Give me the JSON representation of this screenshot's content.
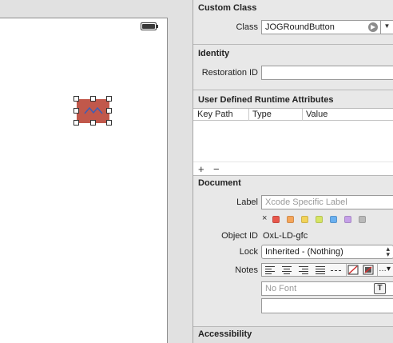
{
  "canvas": {
    "selected_element_color": "#c1584b"
  },
  "custom_class": {
    "title": "Custom Class",
    "class_label": "Class",
    "class_value": "JOGRoundButton"
  },
  "identity": {
    "title": "Identity",
    "restoration_id_label": "Restoration ID",
    "restoration_id_value": ""
  },
  "runtime_attributes": {
    "title": "User Defined Runtime Attributes",
    "columns": [
      "Key Path",
      "Type",
      "Value"
    ],
    "rows": [],
    "add_symbol": "+",
    "remove_symbol": "−"
  },
  "document": {
    "title": "Document",
    "label_label": "Label",
    "label_placeholder": "Xcode Specific Label",
    "color_clear_symbol": "×",
    "color_swatches": [
      "#e8574c",
      "#f5a55a",
      "#f2d35a",
      "#d6e564",
      "#6ab0f0",
      "#c5a0e8",
      "#b9b9b9"
    ],
    "object_id_label": "Object ID",
    "object_id_value": "OxL-LD-gfc",
    "lock_label": "Lock",
    "lock_value": "Inherited - (Nothing)",
    "notes_label": "Notes",
    "notes_buttons": [
      "align-left-icon",
      "align-center-icon",
      "align-right-icon",
      "align-justify-icon",
      "align-natural-icon",
      "no-color-icon",
      "color-well-icon",
      "more-icon"
    ],
    "font_placeholder": "No Font",
    "font_button_symbol": "T",
    "notes_text": ""
  },
  "accessibility": {
    "title": "Accessibility"
  }
}
